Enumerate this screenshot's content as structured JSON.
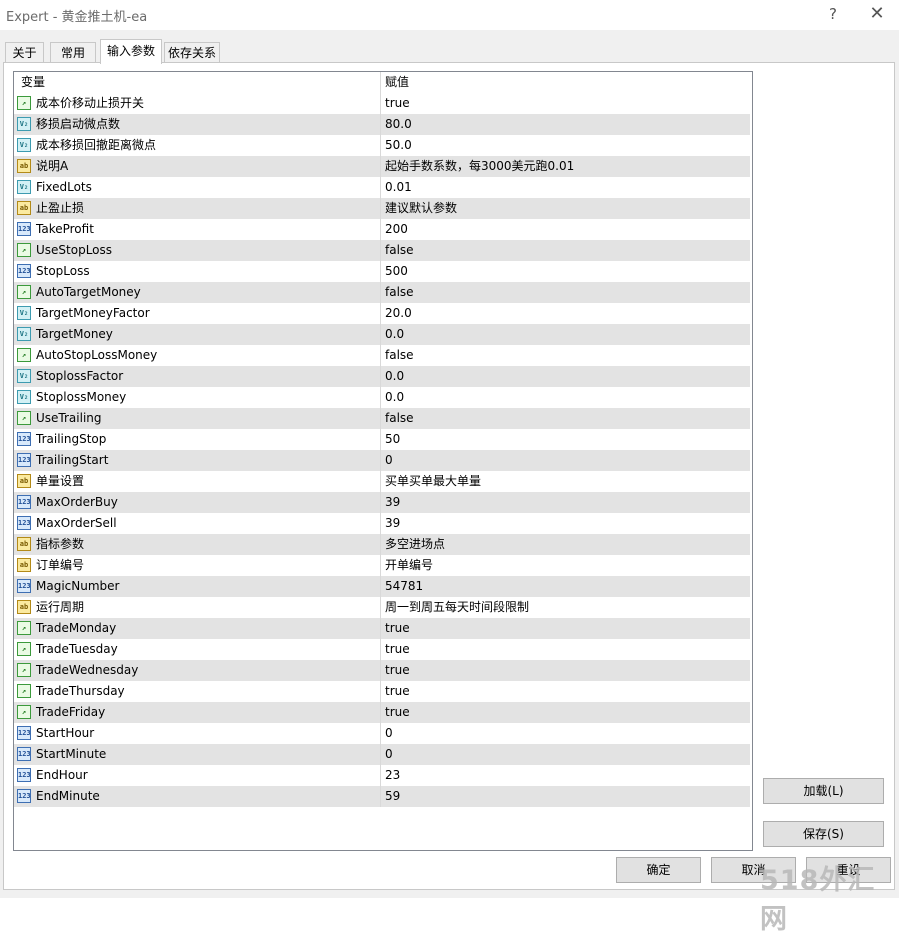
{
  "window": {
    "title": "Expert - 黄金推土机-ea",
    "help": "?",
    "close": "✕"
  },
  "tabs": [
    {
      "label": "关于"
    },
    {
      "label": "常用"
    },
    {
      "label": "输入参数"
    },
    {
      "label": "依存关系"
    }
  ],
  "grid": {
    "headers": {
      "name": "变量",
      "value": "赋值"
    },
    "rows": [
      {
        "type": "bool",
        "name": "成本价移动止损开关",
        "value": "true"
      },
      {
        "type": "dbl",
        "name": "移损启动微点数",
        "value": "80.0"
      },
      {
        "type": "dbl",
        "name": "成本移损回撤距离微点",
        "value": "50.0"
      },
      {
        "type": "str",
        "name": "说明A",
        "value": "起始手数系数，每3000美元跑0.01"
      },
      {
        "type": "dbl",
        "name": "FixedLots",
        "value": "0.01"
      },
      {
        "type": "str",
        "name": "止盈止损",
        "value": "建议默认参数"
      },
      {
        "type": "num",
        "name": "TakeProfit",
        "value": "200"
      },
      {
        "type": "bool",
        "name": "UseStopLoss",
        "value": "false"
      },
      {
        "type": "num",
        "name": "StopLoss",
        "value": "500"
      },
      {
        "type": "bool",
        "name": "AutoTargetMoney",
        "value": "false"
      },
      {
        "type": "dbl",
        "name": "TargetMoneyFactor",
        "value": "20.0"
      },
      {
        "type": "dbl",
        "name": "TargetMoney",
        "value": "0.0"
      },
      {
        "type": "bool",
        "name": "AutoStopLossMoney",
        "value": "false"
      },
      {
        "type": "dbl",
        "name": "StoplossFactor",
        "value": "0.0"
      },
      {
        "type": "dbl",
        "name": "StoplossMoney",
        "value": "0.0"
      },
      {
        "type": "bool",
        "name": "UseTrailing",
        "value": "false"
      },
      {
        "type": "num",
        "name": "TrailingStop",
        "value": "50"
      },
      {
        "type": "num",
        "name": "TrailingStart",
        "value": "0"
      },
      {
        "type": "str",
        "name": "单量设置",
        "value": "买单买单最大单量"
      },
      {
        "type": "num",
        "name": "MaxOrderBuy",
        "value": "39"
      },
      {
        "type": "num",
        "name": "MaxOrderSell",
        "value": "39"
      },
      {
        "type": "str",
        "name": "指标参数",
        "value": "多空进场点"
      },
      {
        "type": "str",
        "name": "订单编号",
        "value": "开单编号"
      },
      {
        "type": "num",
        "name": "MagicNumber",
        "value": "54781"
      },
      {
        "type": "str",
        "name": "运行周期",
        "value": "周一到周五每天时间段限制"
      },
      {
        "type": "bool",
        "name": "TradeMonday",
        "value": "true"
      },
      {
        "type": "bool",
        "name": "TradeTuesday",
        "value": "true"
      },
      {
        "type": "bool",
        "name": "TradeWednesday",
        "value": "true"
      },
      {
        "type": "bool",
        "name": "TradeThursday",
        "value": "true"
      },
      {
        "type": "bool",
        "name": "TradeFriday",
        "value": "true"
      },
      {
        "type": "num",
        "name": "StartHour",
        "value": "0"
      },
      {
        "type": "num",
        "name": "StartMinute",
        "value": "0"
      },
      {
        "type": "num",
        "name": "EndHour",
        "value": "23"
      },
      {
        "type": "num",
        "name": "EndMinute",
        "value": "59"
      }
    ]
  },
  "icons": {
    "bool": {
      "name": "bool-param-icon",
      "glyph": "↗"
    },
    "num": {
      "name": "integer-param-icon",
      "glyph": "123"
    },
    "dbl": {
      "name": "double-param-icon",
      "glyph": "V₂"
    },
    "str": {
      "name": "string-param-icon",
      "glyph": "ab"
    }
  },
  "buttons": {
    "load": "加载(L)",
    "save": "保存(S)",
    "ok": "确定",
    "cancel": "取消",
    "reset": "重设"
  },
  "watermark": "518外汇网"
}
